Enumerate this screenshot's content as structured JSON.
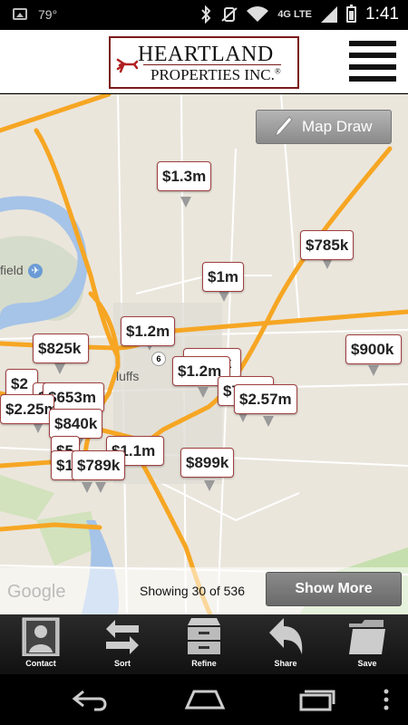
{
  "status_bar": {
    "temperature": "79°",
    "network": "4G LTE",
    "time": "1:41",
    "icons": [
      "image-icon",
      "bluetooth-icon",
      "mute-icon",
      "wifi-icon",
      "signal-icon",
      "battery-icon"
    ]
  },
  "header": {
    "logo_line1": "HEARTLAND",
    "logo_line2": "PROPERTIES INC.",
    "logo_mark": "®",
    "menu_icon": "hamburger-menu-icon"
  },
  "map": {
    "map_draw_label": "Map Draw",
    "place_label_field": "field",
    "place_label_bluffs": "luffs",
    "route_shield": "6",
    "listings": [
      {
        "label": "$1.3m"
      },
      {
        "label": "$785k"
      },
      {
        "label": "$1m"
      },
      {
        "label": "$1.2m"
      },
      {
        "label": "$825k"
      },
      {
        "label": "$900k"
      },
      {
        "label": "$995k"
      },
      {
        "label": "$1.2m"
      },
      {
        "label": "$795k"
      },
      {
        "label": "$2.57m"
      },
      {
        "label": "$2"
      },
      {
        "label": "$4"
      },
      {
        "label": "$653m"
      },
      {
        "label": "$2.25m"
      },
      {
        "label": "$840k"
      },
      {
        "label": "$5"
      },
      {
        "label": "$1.1m"
      },
      {
        "label": "$1"
      },
      {
        "label": "$789k"
      },
      {
        "label": "$899k"
      }
    ],
    "google_label": "Google",
    "showing_text": "Showing 30 of 536",
    "show_more_label": "Show More"
  },
  "action_bar": {
    "items": [
      {
        "label": "Contact",
        "icon": "contact-icon"
      },
      {
        "label": "Sort",
        "icon": "sort-icon"
      },
      {
        "label": "Refine",
        "icon": "refine-icon"
      },
      {
        "label": "Share",
        "icon": "share-icon"
      },
      {
        "label": "Save",
        "icon": "save-folder-icon"
      }
    ]
  },
  "nav_bar": {
    "icons": [
      "back-icon",
      "home-icon",
      "recents-icon",
      "overflow-menu-icon"
    ]
  },
  "colors": {
    "road_major": "#f6a623",
    "road_minor": "#ffffff",
    "water": "#a6c3e8",
    "park": "#c6dfae",
    "pin_border": "#a04040",
    "logo_accent": "#7a1a1a"
  }
}
